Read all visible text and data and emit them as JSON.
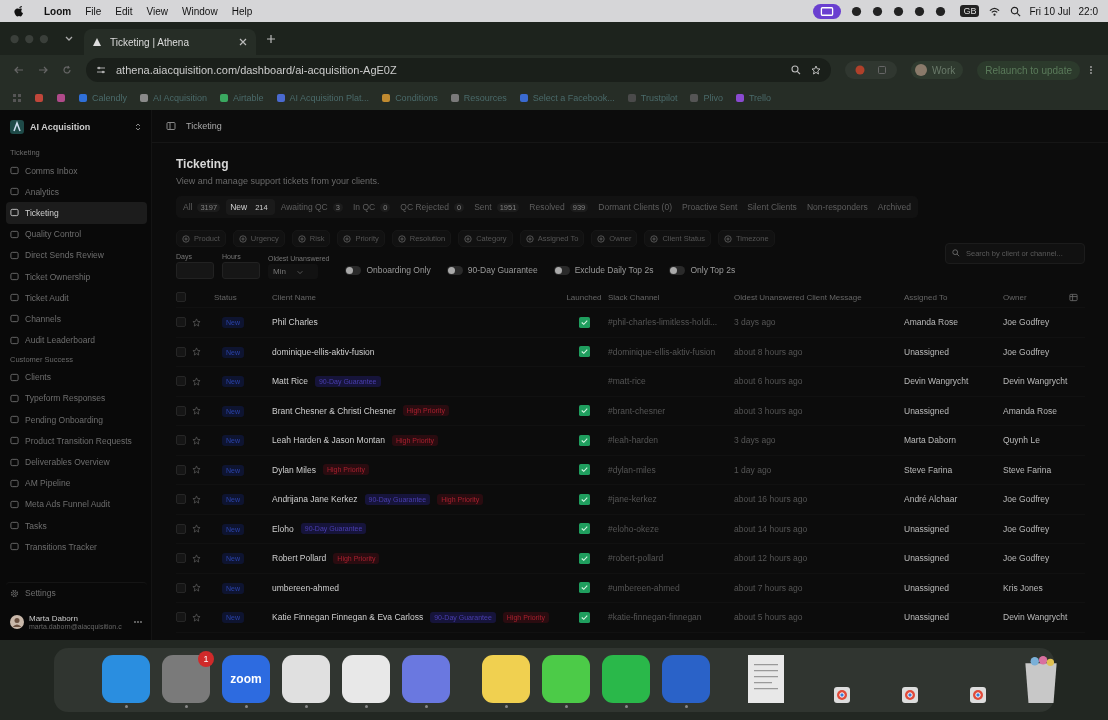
{
  "menu_bar": {
    "app": "Loom",
    "menus": [
      "File",
      "Edit",
      "View",
      "Window",
      "Help"
    ],
    "keyboard": "GB",
    "date": "Fri 10 Jul",
    "time": "22:0"
  },
  "browser": {
    "tab": {
      "title": "Ticketing | Athena",
      "selected": true
    },
    "url": "athena.aiacquisition.com/dashboard/ai-acquisition-AgE0Z",
    "profile": "Work",
    "relaunch": "Relaunch to update",
    "bookmarks": [
      {
        "color": "#c0463a"
      },
      {
        "color": "#b04a8a"
      },
      {
        "label": "Calendly",
        "color": "#2f6fd8"
      },
      {
        "label": "AI Acquisition",
        "color": "#8a8a8a"
      },
      {
        "label": "Airtable",
        "color": "#3aa860"
      },
      {
        "label": "AI Acquisition Plat...",
        "color": "#4a6ad0"
      },
      {
        "label": "Conditions",
        "color": "#c08a30"
      },
      {
        "label": "Resources",
        "color": "#7a7a7a"
      },
      {
        "label": "Select a Facebook...",
        "color": "#3a6ad0"
      },
      {
        "label": "Trustpilot",
        "color": "#4a4a4a"
      },
      {
        "label": "Plivo",
        "color": "#555555"
      },
      {
        "label": "Trello",
        "color": "#8a4ad0"
      }
    ]
  },
  "sidebar": {
    "workspace": "AI Acquisition",
    "sections": [
      {
        "title": "Ticketing",
        "items": [
          {
            "label": "Comms Inbox",
            "selected": false
          },
          {
            "label": "Analytics",
            "selected": false
          },
          {
            "label": "Ticketing",
            "selected": true
          },
          {
            "label": "Quality Control",
            "selected": false
          },
          {
            "label": "Direct Sends Review",
            "selected": false
          },
          {
            "label": "Ticket Ownership",
            "selected": false
          },
          {
            "label": "Ticket Audit",
            "selected": false
          },
          {
            "label": "Channels",
            "selected": false
          },
          {
            "label": "Audit Leaderboard",
            "selected": false
          }
        ]
      },
      {
        "title": "Customer Success",
        "items": [
          {
            "label": "Clients",
            "selected": false
          },
          {
            "label": "Typeform Responses",
            "selected": false
          },
          {
            "label": "Pending Onboarding",
            "selected": false
          },
          {
            "label": "Product Transition Requests",
            "selected": false
          },
          {
            "label": "Deliverables Overview",
            "selected": false
          },
          {
            "label": "AM Pipeline",
            "selected": false
          },
          {
            "label": "Meta Ads Funnel Audit",
            "selected": false
          },
          {
            "label": "Tasks",
            "selected": false
          },
          {
            "label": "Transitions Tracker",
            "selected": false
          }
        ]
      }
    ],
    "settings": "Settings",
    "user": {
      "name": "Marta Daborn",
      "email": "marta.daborn@aiacquisition.c"
    }
  },
  "breadcrumb": "Ticketing",
  "title": "Ticketing",
  "subtitle": "View and manage support tickets from your clients.",
  "status_tabs": [
    {
      "label": "All",
      "count": "3197",
      "selected": false
    },
    {
      "label": "New",
      "count": "214",
      "selected": true
    },
    {
      "label": "Awaiting QC",
      "count": "3",
      "selected": false
    },
    {
      "label": "In QC",
      "count": "0",
      "selected": false
    },
    {
      "label": "QC Rejected",
      "count": "0",
      "selected": false
    },
    {
      "label": "Sent",
      "count": "1951",
      "selected": false
    },
    {
      "label": "Resolved",
      "count": "939",
      "selected": false
    },
    {
      "label": "Dormant Clients (0)",
      "selected": false
    },
    {
      "label": "Proactive Sent",
      "selected": false
    },
    {
      "label": "Silent Clients",
      "selected": false
    },
    {
      "label": "Non-responders",
      "selected": false
    },
    {
      "label": "Archived",
      "selected": false
    }
  ],
  "filters": [
    "Product",
    "Urgency",
    "Risk",
    "Priority",
    "Resolution",
    "Category",
    "Assigned To",
    "Owner",
    "Client Status",
    "Timezone"
  ],
  "days_label": "Days",
  "hours_label": "Hours",
  "oldest_label": "Oldest Unanswered",
  "oldest_value": "Min",
  "toggles": [
    {
      "label": "Onboarding Only",
      "on": false
    },
    {
      "label": "90-Day Guarantee",
      "on": false
    },
    {
      "label": "Exclude Daily Top 2s",
      "on": false
    },
    {
      "label": "Only Top 2s",
      "on": false
    }
  ],
  "search": {
    "placeholder": "Search by client or channel..."
  },
  "table": {
    "all_selected": false,
    "columns": [
      "Status",
      "Client Name",
      "Launched",
      "Slack Channel",
      "Oldest Unanswered Client Message",
      "Assigned To",
      "Owner"
    ],
    "rows": [
      {
        "selected": false,
        "status": "New",
        "name": "Phil Charles",
        "tags": [],
        "launched": true,
        "channel": "#phil-charles-limitless-holdi...",
        "oldest": "3 days ago",
        "assigned": "Amanda Rose",
        "owner": "Joe Godfrey"
      },
      {
        "selected": false,
        "status": "New",
        "name": "dominique-ellis-aktiv-fusion",
        "tags": [],
        "launched": true,
        "channel": "#dominique-ellis-aktiv-fusion",
        "oldest": "about 8 hours ago",
        "assigned": "Unassigned",
        "owner": "Joe Godfrey"
      },
      {
        "selected": false,
        "status": "New",
        "name": "Matt Rice",
        "tags": [
          {
            "kind": "guarantee",
            "label": "90-Day Guarantee"
          }
        ],
        "launched": false,
        "channel": "#matt-rice",
        "oldest": "about 6 hours ago",
        "assigned": "Devin Wangrycht",
        "owner": "Devin Wangrycht"
      },
      {
        "selected": false,
        "status": "New",
        "name": "Brant Chesner & Christi Chesner",
        "tags": [
          {
            "kind": "priority",
            "label": "High Priority"
          }
        ],
        "launched": true,
        "channel": "#brant-chesner",
        "oldest": "about 3 hours ago",
        "assigned": "Unassigned",
        "owner": "Amanda Rose"
      },
      {
        "selected": false,
        "status": "New",
        "name": "Leah Harden & Jason Montan",
        "tags": [
          {
            "kind": "priority",
            "label": "High Priority"
          }
        ],
        "launched": true,
        "channel": "#leah-harden",
        "oldest": "3 days ago",
        "assigned": "Marta Daborn",
        "owner": "Quynh Le"
      },
      {
        "selected": false,
        "status": "New",
        "name": "Dylan Miles",
        "tags": [
          {
            "kind": "priority",
            "label": "High Priority"
          }
        ],
        "launched": true,
        "channel": "#dylan-miles",
        "oldest": "1 day ago",
        "assigned": "Steve Farina",
        "owner": "Steve Farina"
      },
      {
        "selected": false,
        "status": "New",
        "name": "Andrijana Jane Kerkez",
        "tags": [
          {
            "kind": "guarantee",
            "label": "90-Day Guarantee"
          },
          {
            "kind": "priority",
            "label": "High Priority"
          }
        ],
        "launched": true,
        "channel": "#jane-kerkez",
        "oldest": "about 16 hours ago",
        "assigned": "André Alchaar",
        "owner": "Joe Godfrey"
      },
      {
        "selected": false,
        "status": "New",
        "name": "Eloho",
        "tags": [
          {
            "kind": "guarantee",
            "label": "90-Day Guarantee"
          }
        ],
        "launched": true,
        "channel": "#eloho-okeze",
        "oldest": "about 14 hours ago",
        "assigned": "Unassigned",
        "owner": "Joe Godfrey"
      },
      {
        "selected": false,
        "status": "New",
        "name": "Robert Pollard",
        "tags": [
          {
            "kind": "priority",
            "label": "High Priority"
          }
        ],
        "launched": true,
        "channel": "#robert-pollard",
        "oldest": "about 12 hours ago",
        "assigned": "Unassigned",
        "owner": "Joe Godfrey"
      },
      {
        "selected": false,
        "status": "New",
        "name": "umbereen-ahmed",
        "tags": [],
        "launched": true,
        "channel": "#umbereen-ahmed",
        "oldest": "about 7 hours ago",
        "assigned": "Unassigned",
        "owner": "Kris Jones"
      },
      {
        "selected": false,
        "status": "New",
        "name": "Katie Finnegan Finnegan & Eva Carloss",
        "tags": [
          {
            "kind": "guarantee",
            "label": "90-Day Guarantee"
          },
          {
            "kind": "priority",
            "label": "High Priority"
          }
        ],
        "launched": true,
        "channel": "#katie-finnegan-finnegan",
        "oldest": "about 5 hours ago",
        "assigned": "Unassigned",
        "owner": "Devin Wangrycht"
      }
    ]
  },
  "dock": {
    "apps": [
      {
        "kind": "app",
        "color": "#2a8ee0",
        "running": true
      },
      {
        "kind": "app",
        "color": "#7a7a7a",
        "running": true,
        "badge": "1"
      },
      {
        "kind": "app",
        "color": "#2d6be0",
        "running": true,
        "label": "zoom"
      },
      {
        "kind": "app",
        "color": "#e0e0e0",
        "running": true
      },
      {
        "kind": "app",
        "color": "#e8e8e8",
        "running": true
      },
      {
        "kind": "app",
        "color": "#6a78e0",
        "running": true
      },
      {
        "kind": "separator"
      },
      {
        "kind": "app",
        "color": "#f0d050",
        "running": true
      },
      {
        "kind": "app",
        "color": "#4ccb48",
        "running": true
      },
      {
        "kind": "app",
        "color": "#2ab84a",
        "running": true
      },
      {
        "kind": "app",
        "color": "#2a62c8",
        "running": true
      },
      {
        "kind": "separator"
      },
      {
        "kind": "doc"
      },
      {
        "kind": "mini"
      },
      {
        "kind": "mini"
      },
      {
        "kind": "mini"
      },
      {
        "kind": "trash"
      }
    ]
  }
}
